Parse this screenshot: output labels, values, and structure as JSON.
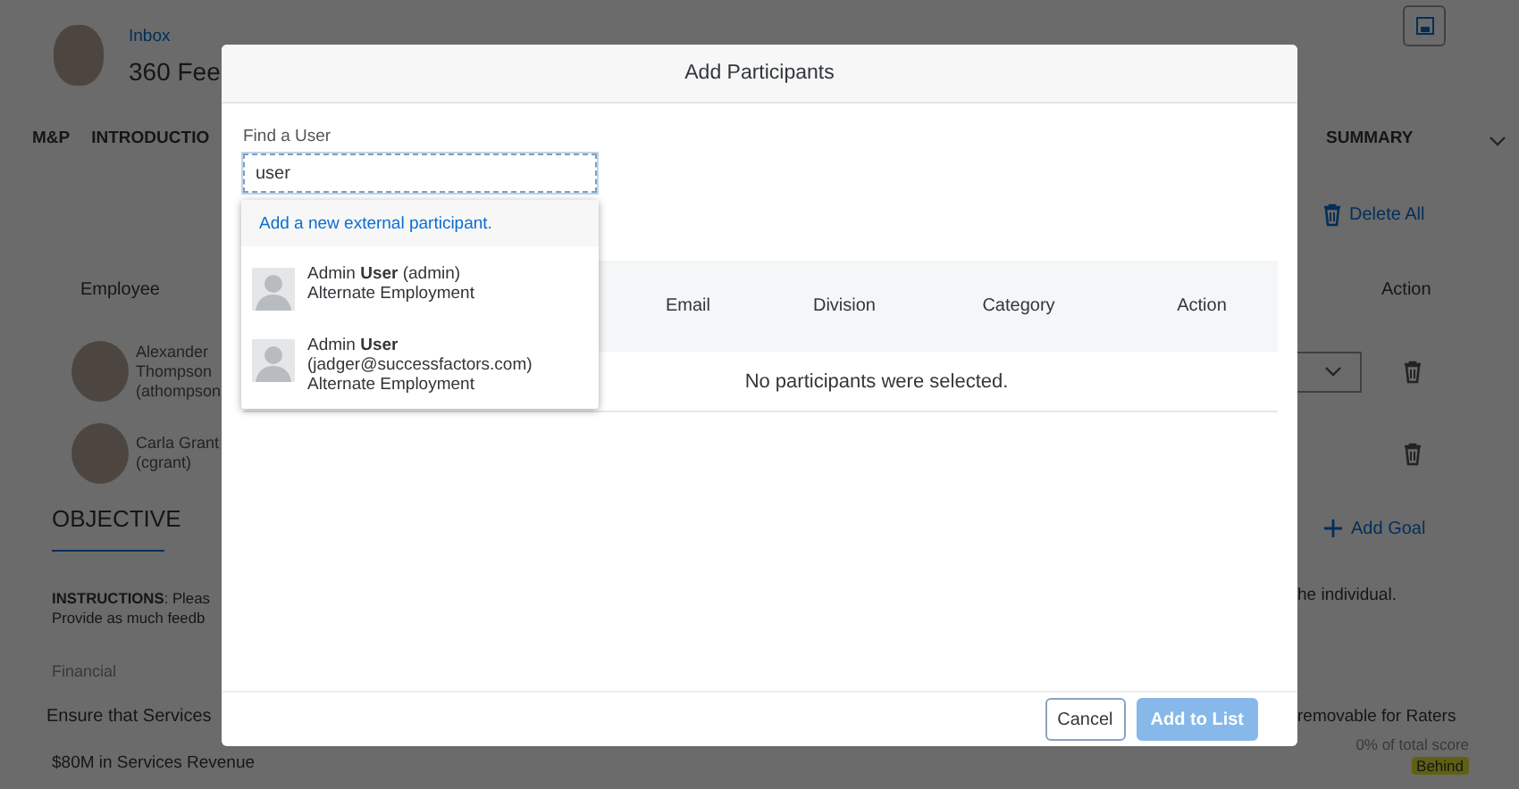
{
  "background": {
    "breadcrumb": "Inbox",
    "title": "360 Fee",
    "tabs": [
      {
        "label": "M&P",
        "selected": false
      },
      {
        "label": "INTRODUCTIO",
        "selected": false
      },
      {
        "label": "SUMMARY",
        "selected": false
      }
    ],
    "delete_all": "Delete All",
    "table": {
      "columns": [
        "Employee",
        "Action"
      ],
      "rows": [
        {
          "lines": [
            "Alexander",
            "Thompson",
            "(athompson"
          ],
          "dropdown": true
        },
        {
          "lines": [
            "Carla Grant",
            "(cgrant)"
          ],
          "dropdown": false
        }
      ]
    },
    "section": {
      "title": "OBJECTIVE",
      "add_goal": "Add Goal",
      "instructions": [
        "**INSTRUCTIONS**: Pleas",
        "Provide as much feedb"
      ],
      "instructions_end": "he individual.",
      "category": "Financial",
      "goal": "Ensure that Services",
      "note": "removable for Raters",
      "goal_metric": "$80M in Services Revenue",
      "weight": "0% of total score",
      "status": "Behind"
    }
  },
  "dialog": {
    "title": "Add Participants",
    "search": {
      "label": "Find a User",
      "value": "user"
    },
    "suggestions": {
      "link": "Add a new external participant.",
      "users": [
        {
          "name": "Admin **User** (admin)",
          "lines": [
            "Alternate Employment"
          ]
        },
        {
          "name": "Admin **User**",
          "lines": [
            "(jadger@successfactors.com)",
            "Alternate Employment"
          ]
        }
      ]
    },
    "table": {
      "columns": [
        "Email",
        "Division",
        "Category",
        "Action"
      ],
      "empty": "No participants were selected."
    },
    "buttons": [
      {
        "label": "Cancel",
        "kind": "secondary",
        "disabled": false
      },
      {
        "label": "Add to List",
        "kind": "primary",
        "disabled": true
      }
    ]
  }
}
